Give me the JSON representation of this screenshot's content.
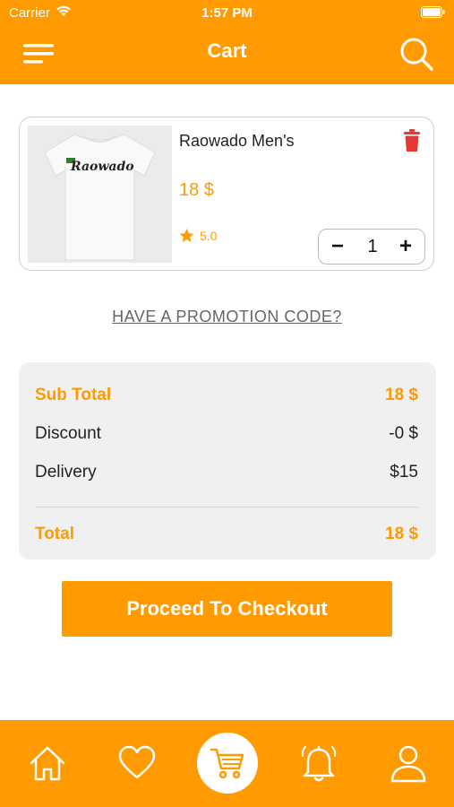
{
  "status_bar": {
    "carrier": "Carrier",
    "time": "1:57 PM"
  },
  "header": {
    "title": "Cart"
  },
  "cart_item": {
    "title": "Raowado Men's",
    "price": "18 $",
    "rating": "5.0",
    "quantity": "1",
    "shirt_logo": "Raowado"
  },
  "promo_link": "HAVE A PROMOTION CODE?",
  "summary": {
    "subtotal_label": "Sub Total",
    "subtotal_value": "18 $",
    "discount_label": "Discount",
    "discount_value": "-0 $",
    "delivery_label": "Delivery",
    "delivery_value": "$15",
    "total_label": "Total",
    "total_value": "18 $"
  },
  "checkout_button": "Proceed To Checkout",
  "colors": {
    "accent": "#FF9A00",
    "delete": "#E53935"
  },
  "tab_bar": {
    "tabs": [
      "home-icon",
      "heart-icon",
      "cart-icon",
      "bell-icon",
      "user-icon"
    ],
    "active": "cart-icon"
  }
}
